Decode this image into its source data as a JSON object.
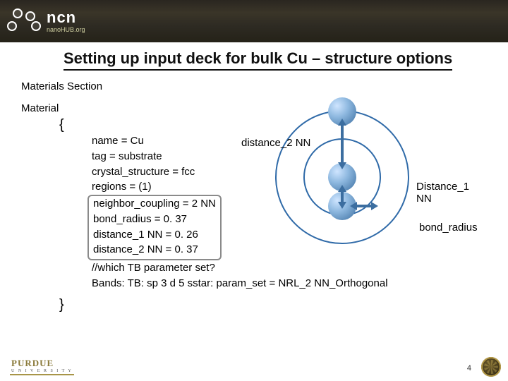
{
  "header": {
    "brand_main": "ncn",
    "brand_sub": "nanoHUB.org"
  },
  "title": "Setting up input deck for bulk Cu – structure options",
  "section_label": "Materials Section",
  "material_label": "Material",
  "brace_open": "{",
  "brace_close": "}",
  "code": {
    "l1": "name = Cu",
    "l2": "tag = substrate",
    "l3": "crystal_structure = fcc",
    "l4": "regions = (1)",
    "l5": "neighbor_coupling = 2 NN",
    "l6": "bond_radius = 0. 37",
    "l7": "distance_1 NN = 0. 26",
    "l8": "distance_2 NN = 0. 37",
    "l9": "//which TB parameter set?",
    "l10": "Bands: TB: sp 3 d 5 sstar: param_set = NRL_2 NN_Orthogonal"
  },
  "diagram": {
    "label_d2nn": "distance_2 NN",
    "label_d1nn": "Distance_1 NN",
    "label_bond_radius": "bond_radius"
  },
  "footer": {
    "purdue": "PURDUE",
    "purdue_sub": "U N I V E R S I T Y",
    "page": "4"
  }
}
